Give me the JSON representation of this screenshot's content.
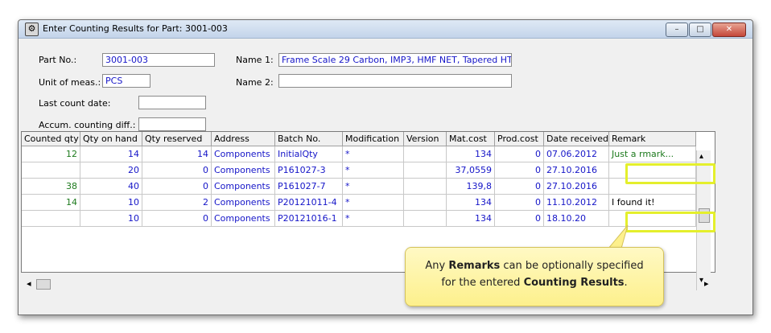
{
  "window": {
    "title": "Enter Counting Results for Part: 3001-003",
    "controls": {
      "minimize": "–",
      "maximize": "□",
      "close": "✕"
    }
  },
  "form": {
    "part_no_label": "Part No.:",
    "part_no_value": "3001-003",
    "name1_label": "Name 1:",
    "name1_value": "Frame Scale 29 Carbon, IMP3, HMF NET, Tapered HT",
    "unit_label": "Unit of meas.:",
    "unit_value": "PCS",
    "name2_label": "Name 2:",
    "name2_value": "",
    "last_count_label": "Last count date:",
    "last_count_value": "",
    "accum_label": "Accum. counting diff.:",
    "accum_value": ""
  },
  "table": {
    "columns": [
      "Counted qty",
      "Qty on hand",
      "Qty reserved",
      "Address",
      "Batch No.",
      "Modification",
      "Version",
      "Mat.cost",
      "Prod.cost",
      "Date received",
      "Remark"
    ],
    "rows": [
      {
        "counted": "12",
        "on_hand": "14",
        "reserved": "14",
        "address": "Components",
        "batch": "InitialQty",
        "modification": "*",
        "version": "",
        "mat_cost": "134",
        "prod_cost": "0",
        "date": "07.06.2012",
        "remark": "Just a rmark..."
      },
      {
        "counted": "",
        "on_hand": "20",
        "reserved": "0",
        "address": "Components",
        "batch": "P161027-3",
        "modification": "*",
        "version": "",
        "mat_cost": "37,0559",
        "prod_cost": "0",
        "date": "27.10.2016",
        "remark": ""
      },
      {
        "counted": "38",
        "on_hand": "40",
        "reserved": "0",
        "address": "Components",
        "batch": "P161027-7",
        "modification": "*",
        "version": "",
        "mat_cost": "139,8",
        "prod_cost": "0",
        "date": "27.10.2016",
        "remark": ""
      },
      {
        "counted": "14",
        "on_hand": "10",
        "reserved": "2",
        "address": "Components",
        "batch": "P20121011-4",
        "modification": "*",
        "version": "",
        "mat_cost": "134",
        "prod_cost": "0",
        "date": "11.10.2012",
        "remark": "I found it!"
      },
      {
        "counted": "",
        "on_hand": "10",
        "reserved": "0",
        "address": "Components",
        "batch": "P20121016-1",
        "modification": "*",
        "version": "",
        "mat_cost": "134",
        "prod_cost": "0",
        "date": "18.10.20",
        "remark": ""
      }
    ]
  },
  "callout": {
    "pre1": "Any ",
    "bold1": "Remarks",
    "post1": " can be optionally specified",
    "pre2": "for the entered ",
    "bold2": "Counting Results",
    "post2": "."
  },
  "scroll": {
    "left_arrow": "◂",
    "right_arrow": "▸",
    "up_arrow": "▴",
    "down_arrow": "▾"
  },
  "colors": {
    "value_text": "#1515c8",
    "counted_text": "#1d7a1d",
    "highlight": "#e4ef2c",
    "callout_bg": "#fdf08c"
  }
}
